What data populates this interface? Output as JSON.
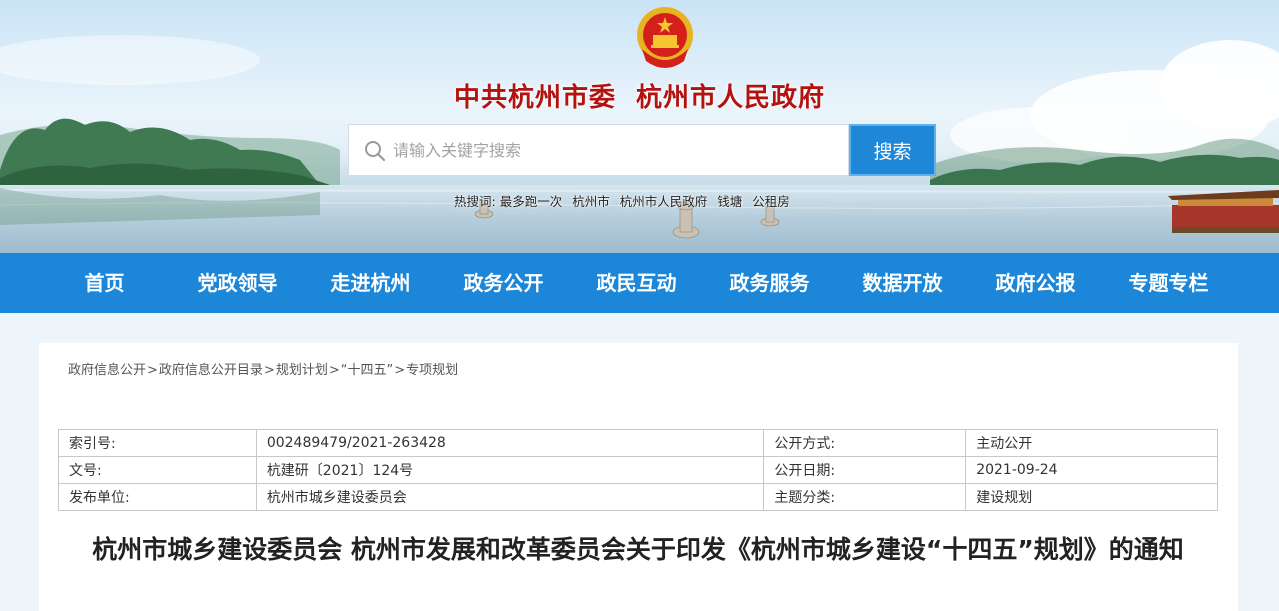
{
  "header": {
    "title_left": "中共杭州市委",
    "title_right": "杭州市人民政府"
  },
  "search": {
    "placeholder": "请输入关键字搜索",
    "button_label": "搜索"
  },
  "hot_words": {
    "label": "热搜词:",
    "items": [
      "最多跑一次",
      "杭州市",
      "杭州市人民政府",
      "钱塘",
      "公租房"
    ]
  },
  "nav": {
    "items": [
      "首页",
      "党政领导",
      "走进杭州",
      "政务公开",
      "政民互动",
      "政务服务",
      "数据开放",
      "政府公报",
      "专题专栏"
    ]
  },
  "breadcrumb": {
    "items": [
      "政府信息公开",
      "政府信息公开目录",
      "规划计划",
      "“十四五”",
      "专项规划"
    ],
    "separator": ">"
  },
  "info_table": {
    "rows": [
      {
        "label1": "索引号:",
        "value1": "002489479/2021-263428",
        "label2": "公开方式:",
        "value2": "主动公开"
      },
      {
        "label1": "文号:",
        "value1": "杭建研〔2021〕124号",
        "label2": "公开日期:",
        "value2": "2021-09-24"
      },
      {
        "label1": "发布单位:",
        "value1": "杭州市城乡建设委员会",
        "label2": "主题分类:",
        "value2": "建设规划"
      }
    ]
  },
  "document": {
    "title": "杭州市城乡建设委员会 杭州市发展和改革委员会关于印发《杭州市城乡建设“十四五”规划》的通知"
  },
  "colors": {
    "nav_bg": "#1c86d8",
    "title_red": "#b3120e",
    "search_button": "#1e87d8",
    "page_bg": "#eef5fb"
  },
  "icons": [
    "national-emblem-icon",
    "search-icon"
  ]
}
